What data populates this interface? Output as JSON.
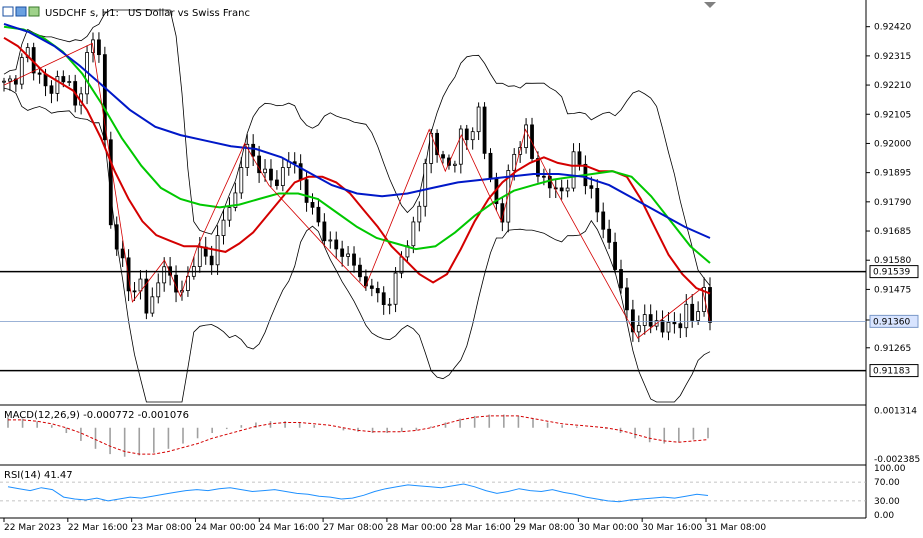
{
  "header": {
    "symbol": "USDCHF",
    "timeframe_suffix": "s, H1:",
    "description": "US Dollar vs Swiss Franc"
  },
  "colors": {
    "background": "#ffffff",
    "border": "#000000",
    "candle": "#000000",
    "ma_fast": "#d40000",
    "ma_mid": "#00c800",
    "ma_slow": "#0018c8",
    "bollinger": "#000000",
    "zigzag": "#d40000",
    "macd_hist": "#a0a0a0",
    "macd_signal": "#d40000",
    "rsi_line": "#1e90ff",
    "price_badge_bg": "#d8e4ff",
    "level_line": "#000000"
  },
  "chart_data": [
    {
      "type": "candlestick",
      "panel": "price",
      "title": "USDCHF, H1: US Dollar vs Swiss Franc",
      "ylim": [
        0.9107,
        0.9248
      ],
      "ytick_labels": [
        "0.92420",
        "0.92315",
        "0.92210",
        "0.92105",
        "0.92000",
        "0.91895",
        "0.91790",
        "0.91685",
        "0.91580",
        "0.91475",
        "0.91365",
        "0.91265"
      ],
      "ytick_values": [
        0.9242,
        0.92315,
        0.9221,
        0.92105,
        0.92,
        0.91895,
        0.9179,
        0.91685,
        0.9158,
        0.91475,
        0.91365,
        0.91265
      ],
      "xtick_labels": [
        "22 Mar 2023",
        "22 Mar 16:00",
        "23 Mar 08:00",
        "24 Mar 00:00",
        "24 Mar 16:00",
        "27 Mar 08:00",
        "28 Mar 00:00",
        "28 Mar 16:00",
        "29 Mar 08:00",
        "30 Mar 00:00",
        "30 Mar 16:00",
        "31 Mar 08:00"
      ],
      "close_path": [
        0.9221,
        0.9222,
        0.9228,
        0.9233,
        0.9226,
        0.9221,
        0.9218,
        0.9226,
        0.9222,
        0.9211,
        0.9228,
        0.9236,
        0.9234,
        0.9175,
        0.9162,
        0.9157,
        0.9143,
        0.915,
        0.914,
        0.9146,
        0.9158,
        0.9149,
        0.9145,
        0.9152,
        0.9162,
        0.9158,
        0.916,
        0.9168,
        0.9178,
        0.9182,
        0.92,
        0.9195,
        0.9192,
        0.9185,
        0.9188,
        0.919,
        0.9196,
        0.9186,
        0.9178,
        0.9172,
        0.9168,
        0.916,
        0.9163,
        0.9158,
        0.9155,
        0.9148,
        0.915,
        0.914,
        0.9145,
        0.9152,
        0.9164,
        0.917,
        0.918,
        0.9205,
        0.9198,
        0.919,
        0.9194,
        0.9203,
        0.92,
        0.9215,
        0.9195,
        0.9182,
        0.9172,
        0.919,
        0.92,
        0.9205,
        0.9192,
        0.9188,
        0.9185,
        0.9182,
        0.9184,
        0.9194,
        0.9192,
        0.9183,
        0.9175,
        0.9168,
        0.9158,
        0.9145,
        0.9138,
        0.913,
        0.914,
        0.9135,
        0.9132,
        0.9137,
        0.9133,
        0.914,
        0.9136,
        0.9148,
        0.9136
      ],
      "horizontal_lines": [
        {
          "value": 0.91539,
          "label": "0.91539"
        },
        {
          "value": 0.91183,
          "label": "0.91183"
        }
      ],
      "current_price": {
        "value": 0.9136,
        "label": "0.91360"
      },
      "overlays": [
        {
          "name": "MA fast",
          "color": "#d40000",
          "values": [
            0.9238,
            0.9235,
            0.923,
            0.9225,
            0.9222,
            0.9219,
            0.9212,
            0.9202,
            0.919,
            0.918,
            0.9172,
            0.9167,
            0.9165,
            0.9163,
            0.9163,
            0.9162,
            0.9161,
            0.9164,
            0.9168,
            0.9174,
            0.918,
            0.9186,
            0.9188,
            0.9188,
            0.9186,
            0.9182,
            0.9176,
            0.917,
            0.9163,
            0.9158,
            0.9153,
            0.915,
            0.9153,
            0.9162,
            0.9172,
            0.918,
            0.9186,
            0.919,
            0.9193,
            0.9195,
            0.9193,
            0.9192,
            0.9192,
            0.919,
            0.919,
            0.9188,
            0.918,
            0.917,
            0.916,
            0.9153,
            0.9148,
            0.9146
          ]
        },
        {
          "name": "MA mid",
          "color": "#00c800",
          "values": [
            0.9242,
            0.9241,
            0.9238,
            0.9233,
            0.9225,
            0.9214,
            0.9202,
            0.9192,
            0.9184,
            0.918,
            0.9178,
            0.9177,
            0.9178,
            0.918,
            0.9182,
            0.9182,
            0.918,
            0.9175,
            0.917,
            0.9166,
            0.9164,
            0.9162,
            0.9163,
            0.9168,
            0.9174,
            0.9179,
            0.9183,
            0.9185,
            0.9187,
            0.9188,
            0.9189,
            0.919,
            0.9188,
            0.9181,
            0.9172,
            0.9163,
            0.9157
          ]
        },
        {
          "name": "MA slow",
          "color": "#0018c8",
          "values": [
            0.9243,
            0.924,
            0.9235,
            0.9228,
            0.922,
            0.9212,
            0.9206,
            0.9203,
            0.9201,
            0.9199,
            0.9198,
            0.9195,
            0.919,
            0.9185,
            0.9182,
            0.9181,
            0.9182,
            0.9184,
            0.9186,
            0.9187,
            0.9188,
            0.9189,
            0.9189,
            0.9188,
            0.9185,
            0.918,
            0.9175,
            0.917,
            0.9166
          ]
        }
      ]
    },
    {
      "type": "bar",
      "panel": "macd",
      "title": "MACD(12,26,9) -0.000772 -0.001076",
      "ytick_labels": [
        "0.001314",
        "-0.002385"
      ],
      "ytick_values": [
        0.001314,
        -0.002385
      ],
      "ylim": [
        -0.0026,
        0.0015
      ],
      "histogram": [
        0.0008,
        0.0007,
        0.0005,
        0.0002,
        -0.0004,
        -0.001,
        -0.0016,
        -0.002,
        -0.0022,
        -0.0021,
        -0.0019,
        -0.0016,
        -0.0012,
        -0.0008,
        -0.0004,
        -0.0001,
        0.0002,
        0.0004,
        0.0005,
        0.0005,
        0.0004,
        0.0002,
        0.0,
        -0.0002,
        -0.0003,
        -0.0004,
        -0.0004,
        -0.0003,
        -0.0002,
        0.0001,
        0.0004,
        0.0007,
        0.0009,
        0.001,
        0.001,
        0.0009,
        0.0007,
        0.0004,
        0.0002,
        0.0001,
        0.0,
        -0.0001,
        -0.0004,
        -0.0008,
        -0.0011,
        -0.0012,
        -0.0011,
        -0.0009,
        -0.0008
      ],
      "signal": [
        0.0006,
        0.0006,
        0.0005,
        0.0003,
        0.0,
        -0.0004,
        -0.0009,
        -0.0014,
        -0.0018,
        -0.002,
        -0.002,
        -0.0018,
        -0.0015,
        -0.0012,
        -0.0008,
        -0.0005,
        -0.0002,
        0.0001,
        0.0003,
        0.0004,
        0.0004,
        0.0003,
        0.0002,
        0.0,
        -0.0002,
        -0.0003,
        -0.0003,
        -0.0003,
        -0.0002,
        0.0,
        0.0003,
        0.0006,
        0.0008,
        0.0009,
        0.0009,
        0.0009,
        0.0007,
        0.0005,
        0.0003,
        0.0002,
        0.0001,
        0.0,
        -0.0002,
        -0.0005,
        -0.0008,
        -0.001,
        -0.0011,
        -0.001,
        -0.0009
      ]
    },
    {
      "type": "line",
      "panel": "rsi",
      "title": "RSI(14) 41.47",
      "ytick_labels": [
        "100.00",
        "70.00",
        "30.00",
        "0.00"
      ],
      "ytick_values": [
        100,
        70,
        30,
        0
      ],
      "ylim": [
        0,
        100
      ],
      "levels": [
        70,
        30
      ],
      "values": [
        60,
        56,
        52,
        58,
        54,
        38,
        34,
        32,
        36,
        30,
        34,
        38,
        36,
        40,
        44,
        48,
        52,
        54,
        52,
        56,
        58,
        54,
        50,
        52,
        54,
        50,
        46,
        44,
        40,
        38,
        34,
        36,
        42,
        50,
        56,
        60,
        64,
        62,
        60,
        58,
        62,
        66,
        60,
        52,
        46,
        50,
        56,
        52,
        50,
        54,
        48,
        44,
        38,
        34,
        30,
        28,
        32,
        34,
        36,
        38,
        36,
        40,
        44,
        41.47
      ]
    }
  ]
}
